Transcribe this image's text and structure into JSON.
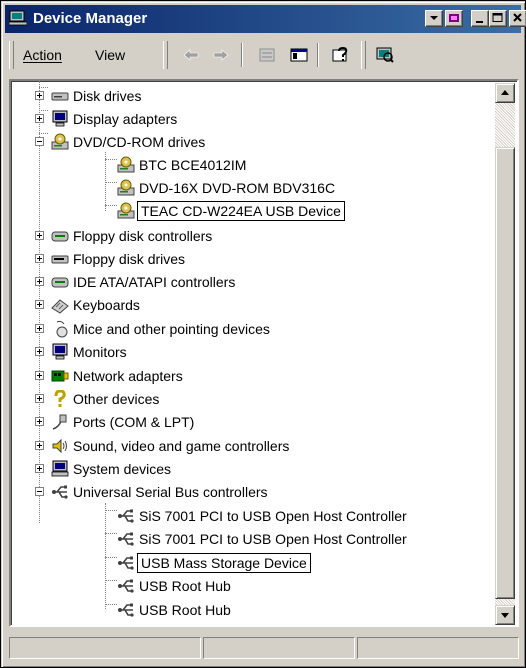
{
  "window": {
    "title": "Device Manager"
  },
  "menu": {
    "action": "Action",
    "view": "View"
  },
  "toolbar_icons": [
    "back-arrow-icon",
    "forward-arrow-icon",
    "properties-icon",
    "console-tree-icon",
    "help-icon",
    "scan-hardware-icon"
  ],
  "tree": {
    "items": [
      {
        "label": "Disk drives",
        "icon": "disk-drive-icon",
        "level": 1,
        "expander": "plus"
      },
      {
        "label": "Display adapters",
        "icon": "monitor-icon",
        "level": 1,
        "expander": "plus"
      },
      {
        "label": "DVD/CD-ROM drives",
        "icon": "cdrom-icon",
        "level": 1,
        "expander": "minus"
      },
      {
        "label": "BTC BCE4012IM",
        "icon": "cdrom-icon",
        "level": 2
      },
      {
        "label": "DVD-16X DVD-ROM BDV316C",
        "icon": "cdrom-icon",
        "level": 2
      },
      {
        "label": "TEAC CD-W224EA USB Device",
        "icon": "cdrom-icon",
        "level": 2,
        "boxed": true
      },
      {
        "label": "Floppy disk controllers",
        "icon": "controller-icon",
        "level": 1,
        "expander": "plus"
      },
      {
        "label": "Floppy disk drives",
        "icon": "floppy-drive-icon",
        "level": 1,
        "expander": "plus"
      },
      {
        "label": "IDE ATA/ATAPI controllers",
        "icon": "controller-icon",
        "level": 1,
        "expander": "plus"
      },
      {
        "label": "Keyboards",
        "icon": "keyboard-icon",
        "level": 1,
        "expander": "plus"
      },
      {
        "label": "Mice and other pointing devices",
        "icon": "mouse-icon",
        "level": 1,
        "expander": "plus"
      },
      {
        "label": "Monitors",
        "icon": "monitor-icon",
        "level": 1,
        "expander": "plus"
      },
      {
        "label": "Network adapters",
        "icon": "network-adapter-icon",
        "level": 1,
        "expander": "plus"
      },
      {
        "label": "Other devices",
        "icon": "question-mark-icon",
        "level": 1,
        "expander": "plus"
      },
      {
        "label": "Ports (COM & LPT)",
        "icon": "port-icon",
        "level": 1,
        "expander": "plus"
      },
      {
        "label": "Sound, video and game controllers",
        "icon": "speaker-icon",
        "level": 1,
        "expander": "plus"
      },
      {
        "label": "System devices",
        "icon": "computer-icon",
        "level": 1,
        "expander": "plus"
      },
      {
        "label": "Universal Serial Bus controllers",
        "icon": "usb-icon",
        "level": 1,
        "expander": "minus"
      },
      {
        "label": "SiS 7001 PCI to USB Open Host Controller",
        "icon": "usb-icon",
        "level": 2
      },
      {
        "label": "SiS 7001 PCI to USB Open Host Controller",
        "icon": "usb-icon",
        "level": 2
      },
      {
        "label": "USB Mass Storage Device",
        "icon": "usb-icon",
        "level": 2,
        "boxed": true
      },
      {
        "label": "USB Root Hub",
        "icon": "usb-icon",
        "level": 2
      },
      {
        "label": "USB Root Hub",
        "icon": "usb-icon",
        "level": 2
      }
    ]
  },
  "colors": {
    "titlebar_start": "#0a246a",
    "titlebar_end": "#3a6ea5",
    "face": "#d4d0c8"
  }
}
